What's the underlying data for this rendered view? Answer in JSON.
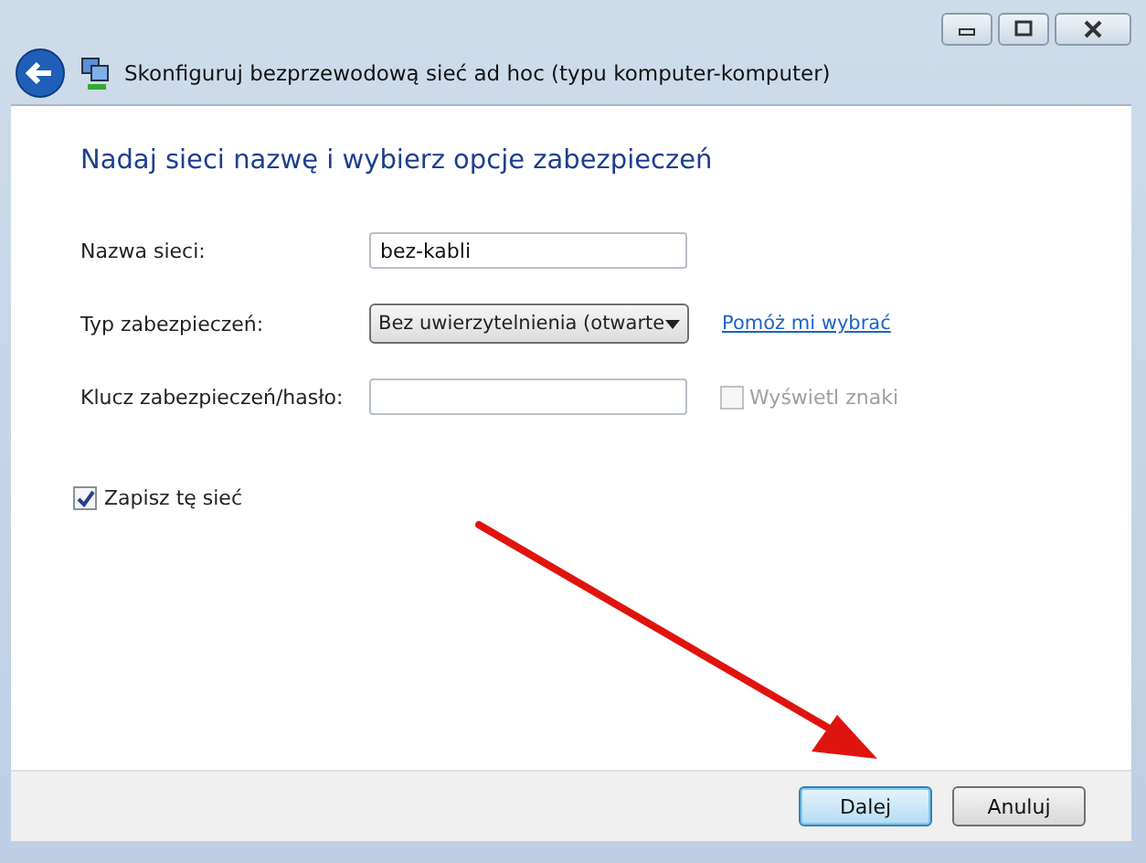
{
  "window": {
    "title": "Skonfiguruj bezprzewodową sieć ad hoc (typu komputer-komputer)"
  },
  "heading": "Nadaj sieci nazwę i wybierz opcje zabezpieczeń",
  "fields": [
    {
      "kind": "text",
      "label": "Nazwa sieci:",
      "value": "bez-kabli"
    },
    {
      "kind": "select",
      "label": "Typ zabezpieczeń:",
      "value": "Bez uwierzytelnienia (otwarte",
      "link": "Pomóż mi wybrać"
    },
    {
      "kind": "password",
      "label": "Klucz zabezpieczeń/hasło:",
      "option": {
        "label": "Wyświetl znaki",
        "checked": false,
        "disabled": true
      }
    }
  ],
  "save": {
    "label": "Zapisz tę sieć",
    "checked": true
  },
  "buttons": [
    {
      "label": "Dalej",
      "default": true
    },
    {
      "label": "Anuluj",
      "default": false
    }
  ]
}
